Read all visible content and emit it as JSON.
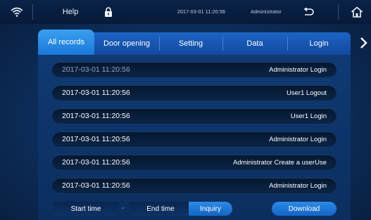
{
  "topbar": {
    "help_label": "Help",
    "datetime": "2017-03-01  11:20:56",
    "user": "Administrator",
    "icons": [
      "wifi-icon",
      "lock-icon",
      "back-icon",
      "home-icon"
    ]
  },
  "tabs": [
    {
      "label": "All records",
      "active": true
    },
    {
      "label": "Door opening",
      "active": false
    },
    {
      "label": "Setting",
      "active": false
    },
    {
      "label": "Data",
      "active": false
    },
    {
      "label": "Login",
      "active": false
    }
  ],
  "records": [
    {
      "time": "2017-03-01  11:20:56",
      "event": "Administrator Login"
    },
    {
      "time": "2017-03-01  11:20:56",
      "event": "User1 Logout"
    },
    {
      "time": "2017-03-01  11:20:56",
      "event": "User1 Login"
    },
    {
      "time": "2017-03-01  11:20:56",
      "event": "Administrator Login"
    },
    {
      "time": "2017-03-01  11:20:56",
      "event": "Administrator Create a userUse"
    },
    {
      "time": "2017-03-01  11:20:56",
      "event": "Administrator Login"
    }
  ],
  "bottom": {
    "start_time_label": "Start time",
    "separator": "-",
    "end_time_label": "End time",
    "inquiry_label": "Inquiry",
    "download_label": "Download"
  },
  "colors": {
    "background": "#0c2d5a",
    "tab_active": "#2a8ce6",
    "tab_bar": "#1a5bb8",
    "row": "#071b38",
    "text": "#ffffff"
  }
}
